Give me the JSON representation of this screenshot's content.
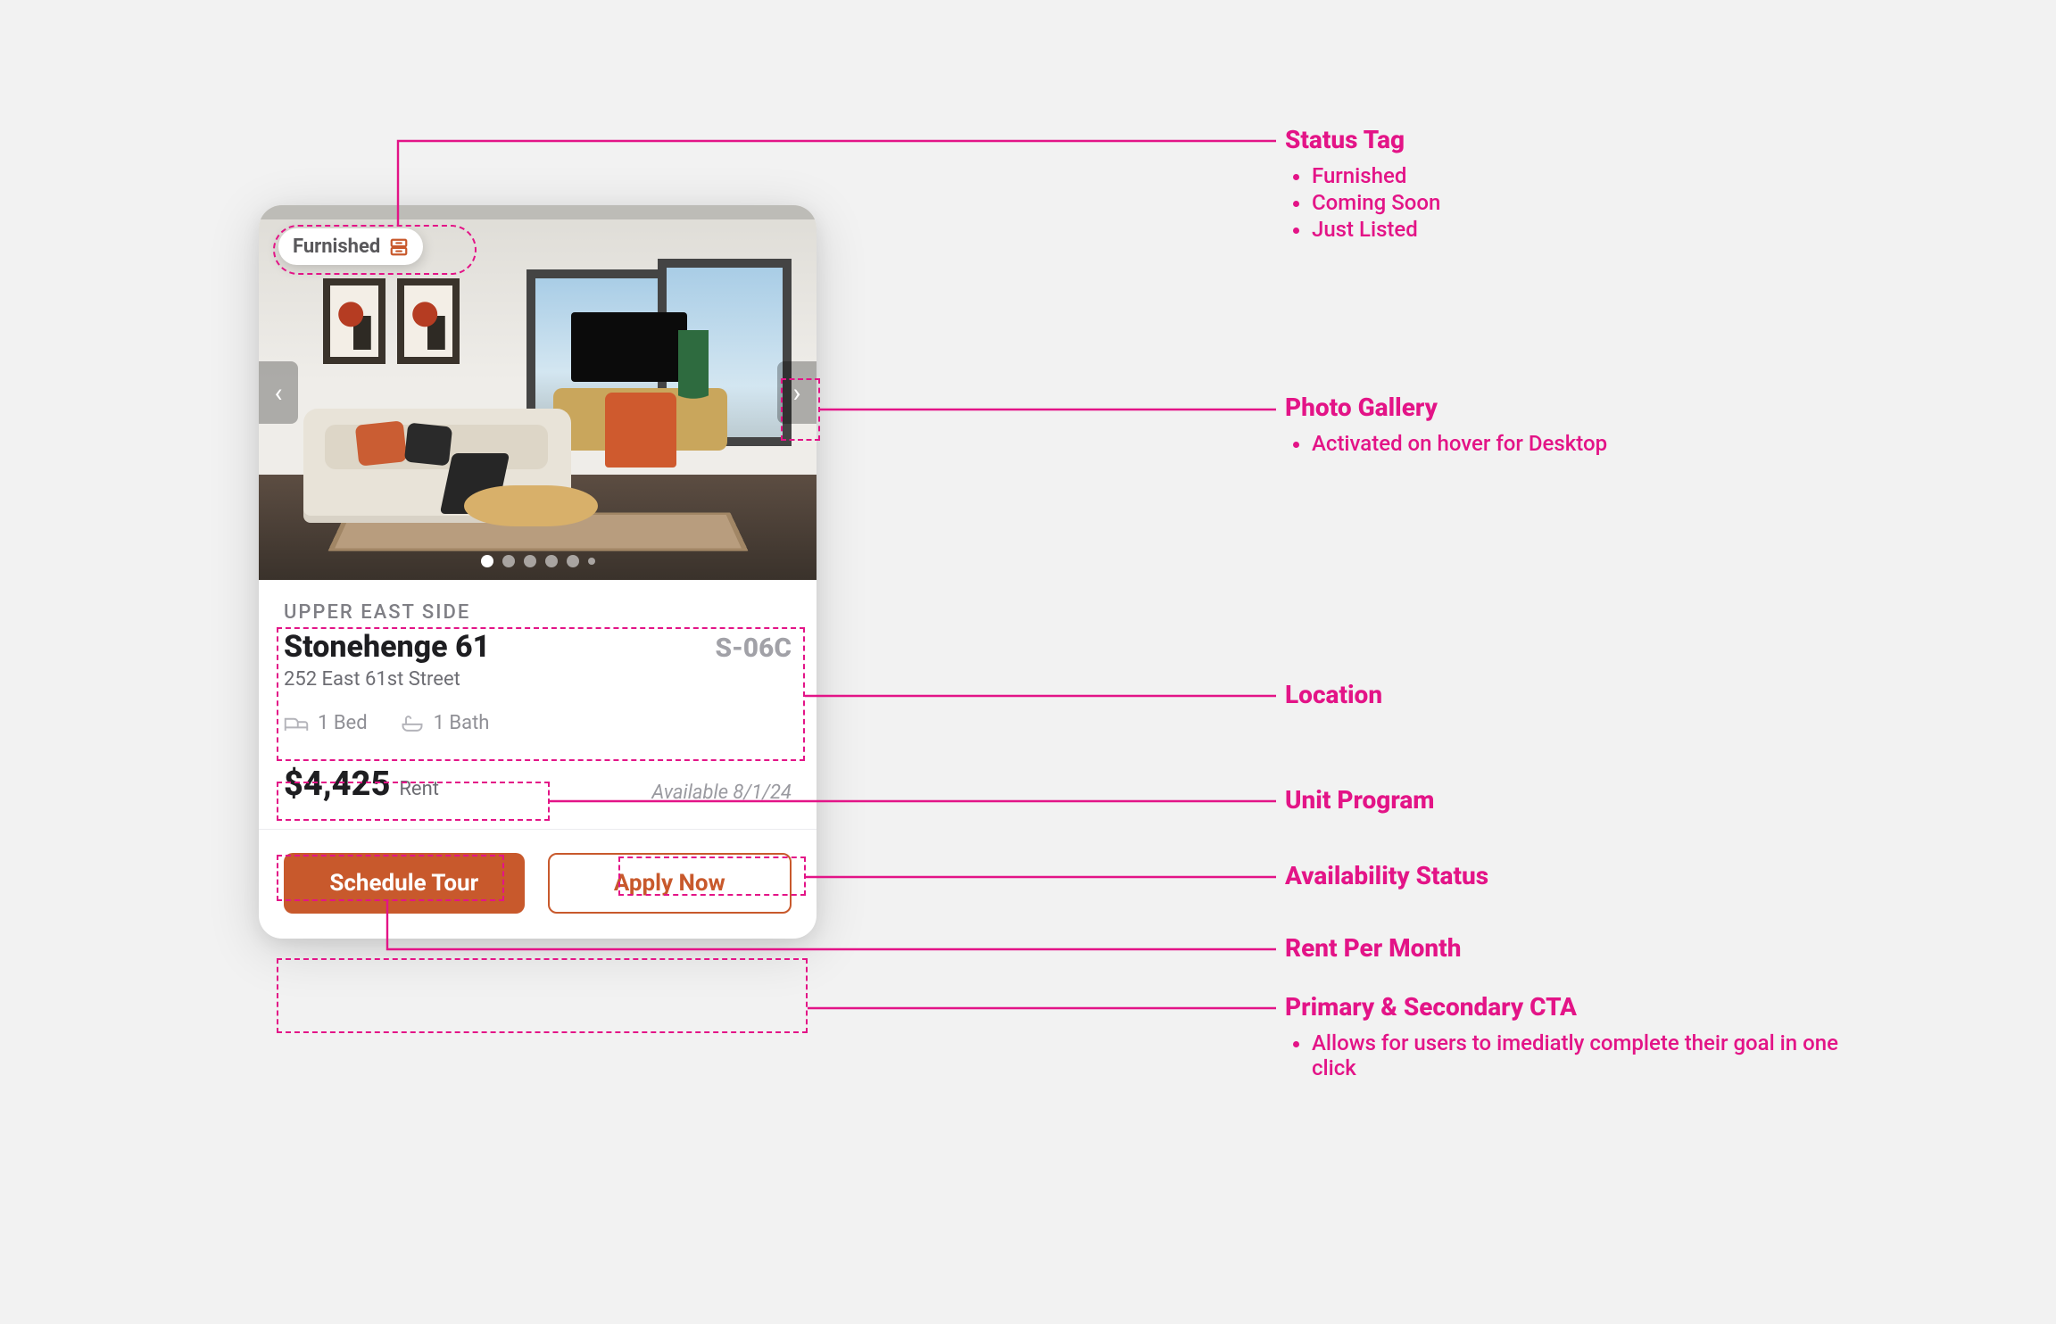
{
  "card": {
    "status_tag": "Furnished",
    "neighborhood": "UPPER EAST SIDE",
    "building_name": "Stonehenge 61",
    "unit_code": "S-06C",
    "address": "252 East 61st Street",
    "beds": "1 Bed",
    "baths": "1 Bath",
    "price": "$4,425",
    "price_suffix": "Rent",
    "availability": "Available 8/1/24",
    "cta_primary": "Schedule Tour",
    "cta_secondary": "Apply Now"
  },
  "annotations": {
    "status_tag": {
      "title": "Status Tag",
      "items": [
        "Furnished",
        "Coming Soon",
        "Just Listed"
      ]
    },
    "photo_gallery": {
      "title": "Photo Gallery",
      "items": [
        "Activated on hover for Desktop"
      ]
    },
    "location": {
      "title": "Location"
    },
    "unit_program": {
      "title": "Unit Program"
    },
    "availability": {
      "title": "Availability Status"
    },
    "rent": {
      "title": "Rent Per Month"
    },
    "cta": {
      "title": "Primary & Secondary CTA",
      "items": [
        "Allows for users to imediatly complete their goal in one click"
      ]
    }
  }
}
